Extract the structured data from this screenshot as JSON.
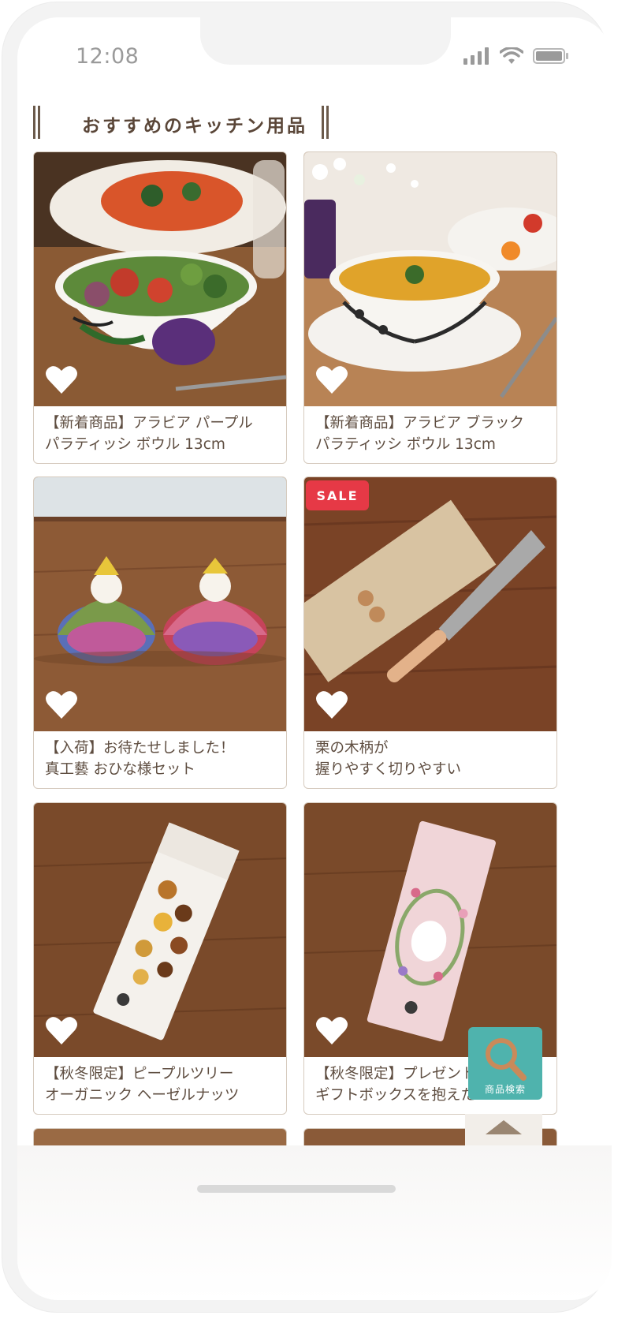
{
  "status": {
    "time": "12:08"
  },
  "section": {
    "title": "おすすめのキッチン用品"
  },
  "products": [
    {
      "line1": "【新着商品】アラビア パープル",
      "line2": "パラティッシ ボウル 13cm",
      "photo": "purple-paratiisi-bowl-photo"
    },
    {
      "line1": "【新着商品】アラビア ブラック",
      "line2": "パラティッシ ボウル 13cm",
      "photo": "black-paratiisi-bowl-photo"
    },
    {
      "line1": "【入荷】お待たせしました！",
      "line2": "真工藝 おひな様セット",
      "photo": "hina-doll-set-photo"
    },
    {
      "line1": "栗の木柄が",
      "line2": "握りやすく切りやすい",
      "photo": "chestnut-handle-knife-photo",
      "badge": "SALE"
    },
    {
      "line1": "【秋冬限定】ピープルツリー",
      "line2": "オーガニック ヘーゼルナッツ",
      "photo": "people-tree-hazelnut-chocolate-photo"
    },
    {
      "line1": "【秋冬限定】プレゼント",
      "line2": "ギフトボックスを抱えた",
      "photo": "people-tree-milk-chocolate-photo"
    }
  ],
  "search_button": {
    "label": "商品検索"
  },
  "colors": {
    "heading_text": "#5a4638",
    "card_border": "#d6cbbf",
    "sale": "#e63946",
    "search": "#4fb3ad"
  }
}
